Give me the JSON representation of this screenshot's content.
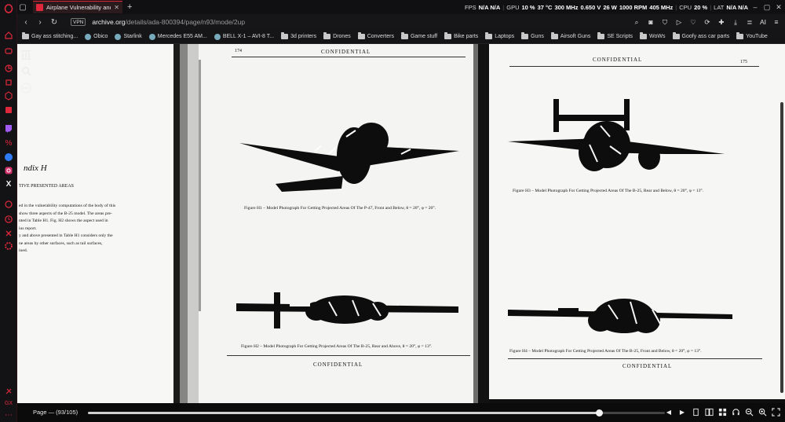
{
  "browser": {
    "tab_title": "Airplane Vulnerability and C",
    "url_host": "archive.org",
    "url_path": "/details/ada-800394/page/n93/mode/2up",
    "vpn_label": "VPN",
    "ai_label": "AI",
    "accent": "#e0283c"
  },
  "hwinfo": {
    "fps_label": "FPS",
    "fps_value": "N/A N/A",
    "gpu_label": "GPU",
    "gpu_load": "10 %",
    "gpu_temp": "37 °C",
    "gpu_clock": "300 MHz",
    "gpu_volt": "0.650 V",
    "gpu_power": "26 W",
    "gpu_fan": "1000 RPM",
    "gpu_mem": "405 MHz",
    "cpu_label": "CPU",
    "cpu_load": "20 %",
    "lat_label": "LAT",
    "lat_value": "N/A N/A"
  },
  "bookmarks": [
    {
      "label": "Gay ass stitching...",
      "icon": "folder-icon"
    },
    {
      "label": "Obico",
      "icon": "obico-icon"
    },
    {
      "label": "Starlink",
      "icon": "starlink-icon"
    },
    {
      "label": "Mercedes E55 AM...",
      "icon": "mercedes-icon"
    },
    {
      "label": "BELL X-1 – AVI-8 T...",
      "icon": "page-icon"
    },
    {
      "label": "3d printers",
      "icon": "folder-icon"
    },
    {
      "label": "Drones",
      "icon": "folder-icon"
    },
    {
      "label": "Converters",
      "icon": "folder-icon"
    },
    {
      "label": "Game stuff",
      "icon": "folder-icon"
    },
    {
      "label": "Bike parts",
      "icon": "folder-icon"
    },
    {
      "label": "Laptops",
      "icon": "folder-icon"
    },
    {
      "label": "Guns",
      "icon": "folder-icon"
    },
    {
      "label": "Airsoft Guns",
      "icon": "folder-icon"
    },
    {
      "label": "SE Scripts",
      "icon": "folder-icon"
    },
    {
      "label": "WoWs",
      "icon": "folder-icon"
    },
    {
      "label": "Goofy ass car parts",
      "icon": "folder-icon"
    },
    {
      "label": "YouTube",
      "icon": "folder-icon"
    }
  ],
  "document": {
    "prev_heading": "ndix H",
    "prev_subheading": "TIVE PRESENTED AREAS",
    "prev_lines": [
      "ed in the vulnerability computations of the body of this",
      "show three aspects of the B-25 model.  The areas pre-",
      "nted in Table H1.  Fig. H2 shows the aspect used in",
      "ius report.",
      "y and above presented in Table H1 considers only the",
      "ne areas by other surfaces, such as tail surfaces,",
      "ined."
    ],
    "left_page_number": "174",
    "right_page_number": "175",
    "confidential": "CONFIDENTIAL",
    "captions": {
      "h1": "Figure H1 – Model Photograph For Getting Projected Areas Of The P-47, Front and Below, θ = 20°, φ = 20°.",
      "h2": "Figure H2 – Model Photograph For Getting Projected Areas Of The B-25, Rear and Above, θ = 20°, φ = 13°.",
      "h3": "Figure H3 – Model Photograph For Getting Projected Areas Of The B-25, Rear and Below, θ = 20°, φ = 13°.",
      "h4": "Figure H4 – Model Photograph For Getting Projected Areas Of The B-25, Front and Below, θ = 20°, φ = 13°."
    }
  },
  "reader": {
    "page_label": "Page — (93/105)",
    "progress": 0.886
  }
}
